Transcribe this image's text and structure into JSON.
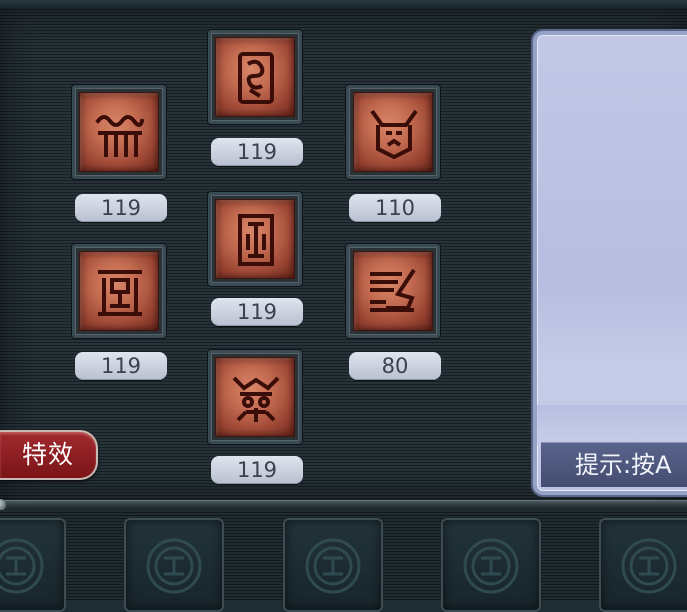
{
  "rune_slots": [
    {
      "icon": "rune-cloud-glyph-icon",
      "level": "119"
    },
    {
      "icon": "rune-spiral-glyph-icon",
      "level": "119"
    },
    {
      "icon": "rune-beast-mask-icon",
      "level": "110"
    },
    {
      "icon": "rune-square-glyph-icon",
      "level": "119"
    },
    {
      "icon": "rune-tower-glyph-icon",
      "level": "119"
    },
    {
      "icon": "rune-dragon-glyph-icon",
      "level": "80"
    },
    {
      "icon": "rune-demon-face-icon",
      "level": "119"
    }
  ],
  "effects_button": {
    "label": "特效"
  },
  "hint": {
    "text": "提示:按A"
  },
  "inventory": {
    "slot_icon": "coin-emblem-icon",
    "slot_count": 5
  },
  "colors": {
    "rune_face": "#c26a50",
    "level_badge": "#d0d6e2",
    "effects_button": "#8e1e22",
    "hint_panel": "#bcc2e1"
  }
}
